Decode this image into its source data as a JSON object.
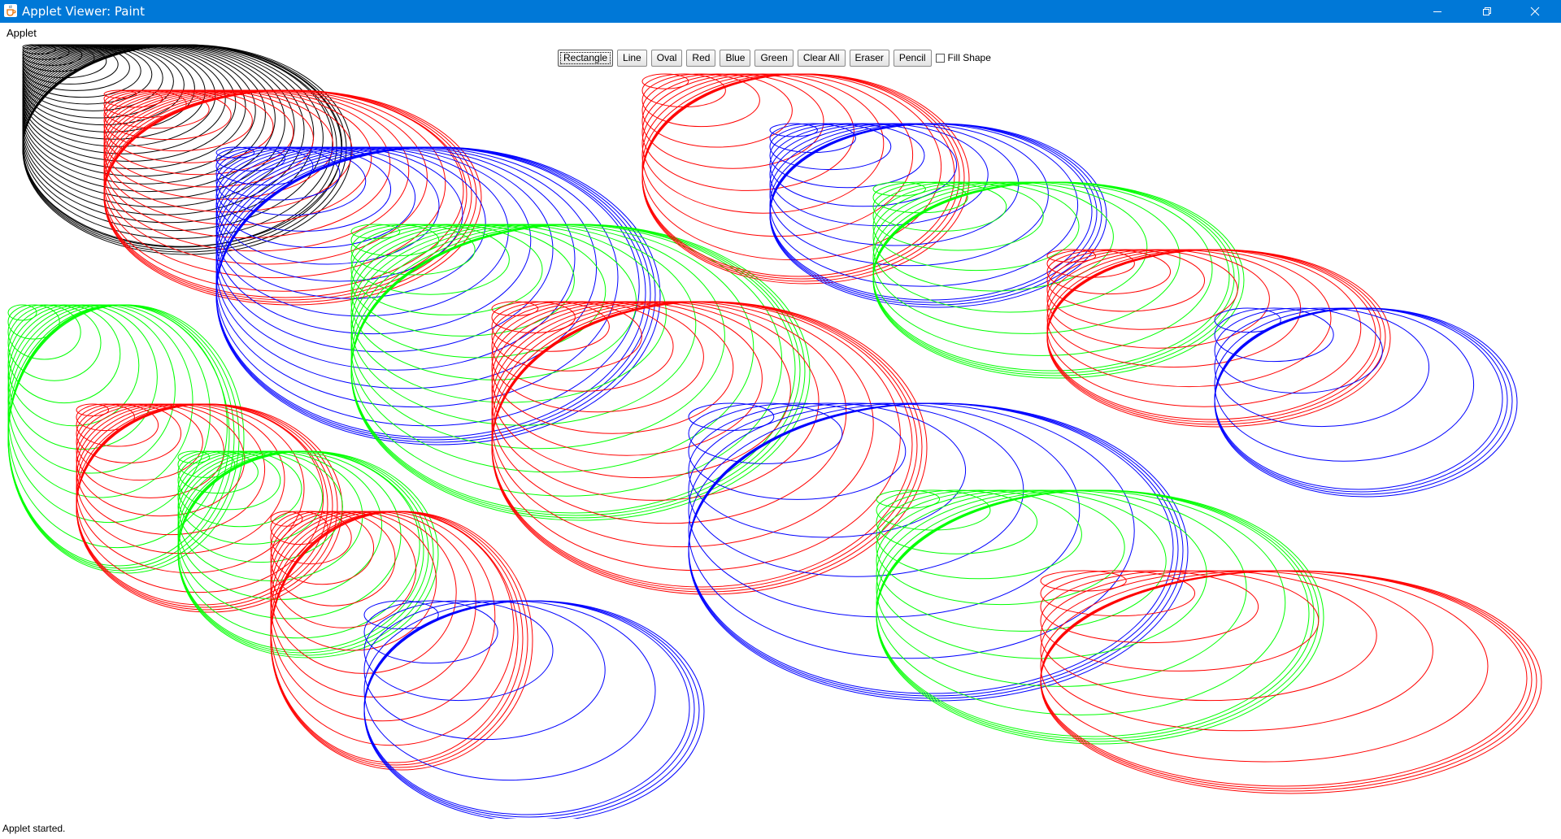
{
  "window": {
    "title": "Applet Viewer: Paint",
    "titlebar_color": "#0078d7",
    "icon": "java-cup-icon",
    "controls": [
      "minimize-icon",
      "restore-icon",
      "close-icon"
    ]
  },
  "menubar": {
    "items": [
      {
        "label": "Applet"
      }
    ]
  },
  "toolbar": {
    "buttons": [
      {
        "label": "Rectangle",
        "active": true
      },
      {
        "label": "Line"
      },
      {
        "label": "Oval"
      },
      {
        "label": "Red"
      },
      {
        "label": "Blue"
      },
      {
        "label": "Green"
      },
      {
        "label": "Clear All"
      },
      {
        "label": "Eraser"
      },
      {
        "label": "Pencil"
      }
    ],
    "fill_shape": {
      "label": "Fill Shape",
      "checked": false
    }
  },
  "canvas": {
    "background": "#ffffff",
    "stroke_colors": {
      "black": "#000000",
      "red": "#ff0000",
      "blue": "#0000ff",
      "green": "#00ff00"
    }
  },
  "status": {
    "text": "Applet started."
  }
}
